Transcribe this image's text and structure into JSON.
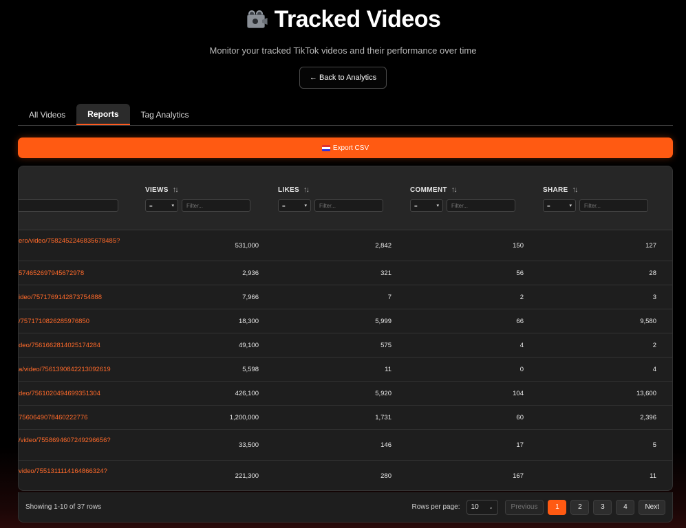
{
  "header": {
    "title": "Tracked Videos",
    "subtitle": "Monitor your tracked TikTok videos and their performance over time",
    "back_label": "← Back to Analytics"
  },
  "tabs": [
    {
      "label": "All Videos",
      "active": false
    },
    {
      "label": "Reports",
      "active": true
    },
    {
      "label": "Tag Analytics",
      "active": false
    }
  ],
  "export": {
    "label": "Export CSV",
    "icon": "flag-icon"
  },
  "table": {
    "columns": [
      {
        "key": "views",
        "label": "VIEWS"
      },
      {
        "key": "likes",
        "label": "LIKES"
      },
      {
        "key": "comment",
        "label": "COMMENT"
      },
      {
        "key": "share",
        "label": "SHARE"
      }
    ],
    "filter_op": "=",
    "filter_placeholder": "Filter...",
    "rows": [
      {
        "url": "ero/video/7582452246835678485?",
        "views": "531,000",
        "likes": "2,842",
        "comment": "150",
        "share": "127",
        "tall": true
      },
      {
        "url": "574652697945672978",
        "views": "2,936",
        "likes": "321",
        "comment": "56",
        "share": "28",
        "tall": false
      },
      {
        "url": "ideo/7571769142873754888",
        "views": "7,966",
        "likes": "7",
        "comment": "2",
        "share": "3",
        "tall": false
      },
      {
        "url": "/7571710826285976850",
        "views": "18,300",
        "likes": "5,999",
        "comment": "66",
        "share": "9,580",
        "tall": false
      },
      {
        "url": "deo/7561662814025174284",
        "views": "49,100",
        "likes": "575",
        "comment": "4",
        "share": "2",
        "tall": false
      },
      {
        "url": "a/video/7561390842213092619",
        "views": "5,598",
        "likes": "11",
        "comment": "0",
        "share": "4",
        "tall": false
      },
      {
        "url": "deo/7561020494699351304",
        "views": "426,100",
        "likes": "5,920",
        "comment": "104",
        "share": "13,600",
        "tall": false
      },
      {
        "url": "7560649078460222776",
        "views": "1,200,000",
        "likes": "1,731",
        "comment": "60",
        "share": "2,396",
        "tall": false
      },
      {
        "url": "/video/7558694607249296656?",
        "views": "33,500",
        "likes": "146",
        "comment": "17",
        "share": "5",
        "tall": true
      },
      {
        "url": "video/7551311114164866324?",
        "views": "221,300",
        "likes": "280",
        "comment": "167",
        "share": "11",
        "tall": true
      }
    ]
  },
  "pagination": {
    "showing": "Showing 1-10 of 37 rows",
    "rows_per_page_label": "Rows per page:",
    "rows_per_page": "10",
    "previous": "Previous",
    "next": "Next",
    "pages": [
      "1",
      "2",
      "3",
      "4"
    ],
    "current_page": "1"
  },
  "colors": {
    "accent": "#ff5a12",
    "link": "#ff6a2a"
  }
}
